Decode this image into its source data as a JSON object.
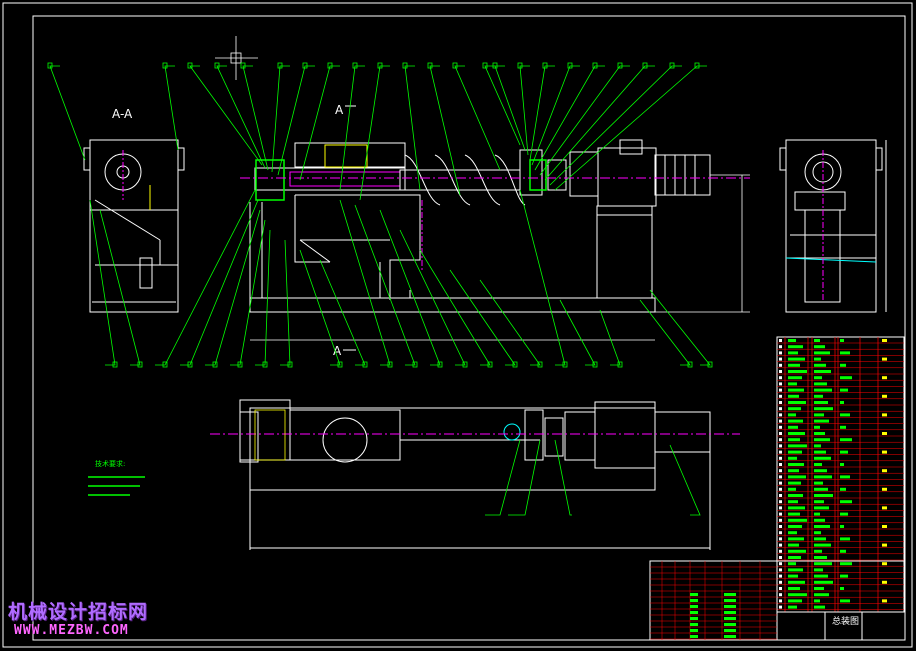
{
  "views": {
    "section_label": "A-A",
    "cut_label_top": "A",
    "cut_label_bottom": "A"
  },
  "notes": {
    "title": "技术要求:"
  },
  "title_block": {
    "drawing_name": "总装图"
  },
  "watermark": {
    "site_name": "机械设计招标网",
    "url": "WWW.MEZBW.COM"
  },
  "colors": {
    "background": "#000000",
    "outline": "#ffffff",
    "leader": "#00ff00",
    "centerline": "#ff00ff",
    "table_lines": "#ff0000",
    "highlight": "#ffff00",
    "accent": "#00ffff"
  }
}
